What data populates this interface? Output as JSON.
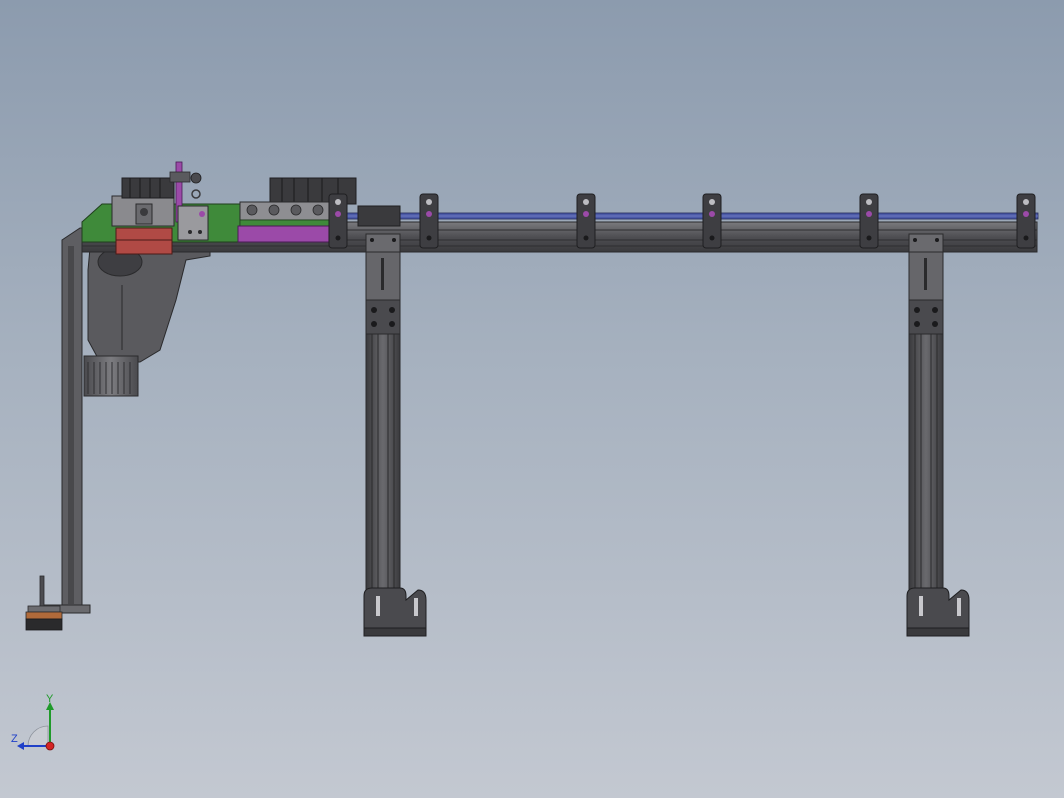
{
  "viewport": {
    "background_top": "#8c9bae",
    "background_bottom": "#c3c8d1"
  },
  "model": {
    "frame_color": "#5b5b5e",
    "frame_edge_color": "#2a2a2c",
    "accent_green": "#3f8a3a",
    "accent_magenta": "#9b4aa8",
    "accent_red": "#b04a45",
    "rail_blue": "#4b5aa8"
  },
  "triad": {
    "y_label": "Y",
    "z_label": "Z",
    "x_color": "#d42424",
    "y_color": "#1f9a2a",
    "z_color": "#2040c8"
  }
}
